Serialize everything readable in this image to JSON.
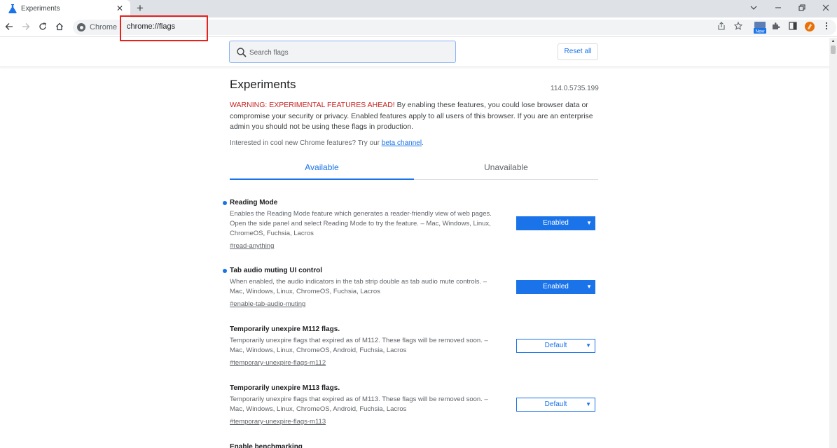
{
  "browser": {
    "tab_title": "Experiments",
    "tab_close": "✕",
    "new_tab": "+",
    "chip_label": "Chrome",
    "url": "chrome://flags",
    "new_badge": "New"
  },
  "search": {
    "placeholder": "Search flags",
    "reset_label": "Reset all"
  },
  "header": {
    "title": "Experiments",
    "version": "114.0.5735.199",
    "warning_prefix": "WARNING: EXPERIMENTAL FEATURES AHEAD!",
    "warning_text": " By enabling these features, you could lose browser data or compromise your security or privacy. Enabled features apply to all users of this browser. If you are an enterprise admin you should not be using these flags in production.",
    "beta_text": "Interested in cool new Chrome features? Try our ",
    "beta_link": "beta channel",
    "beta_suffix": "."
  },
  "tabs": {
    "available": "Available",
    "unavailable": "Unavailable"
  },
  "flags": [
    {
      "name": "Reading Mode",
      "description": "Enables the Reading Mode feature which generates a reader-friendly view of web pages. Open the side panel and select Reading Mode to try the feature. – Mac, Windows, Linux, ChromeOS, Fuchsia, Lacros",
      "link": "#read-anything",
      "value": "Enabled"
    },
    {
      "name": "Tab audio muting UI control",
      "description": "When enabled, the audio indicators in the tab strip double as tab audio mute controls. – Mac, Windows, Linux, ChromeOS, Fuchsia, Lacros",
      "link": "#enable-tab-audio-muting",
      "value": "Enabled"
    },
    {
      "name": "Temporarily unexpire M112 flags.",
      "description": "Temporarily unexpire flags that expired as of M112. These flags will be removed soon. – Mac, Windows, Linux, ChromeOS, Android, Fuchsia, Lacros",
      "link": "#temporary-unexpire-flags-m112",
      "value": "Default"
    },
    {
      "name": "Temporarily unexpire M113 flags.",
      "description": "Temporarily unexpire flags that expired as of M113. These flags will be removed soon. – Mac, Windows, Linux, ChromeOS, Android, Fuchsia, Lacros",
      "link": "#temporary-unexpire-flags-m113",
      "value": "Default"
    },
    {
      "name": "Enable benchmarking"
    }
  ],
  "colors": {
    "accent": "#1a73e8",
    "warning": "#c5221f",
    "highlight_box": "#e8221b"
  }
}
